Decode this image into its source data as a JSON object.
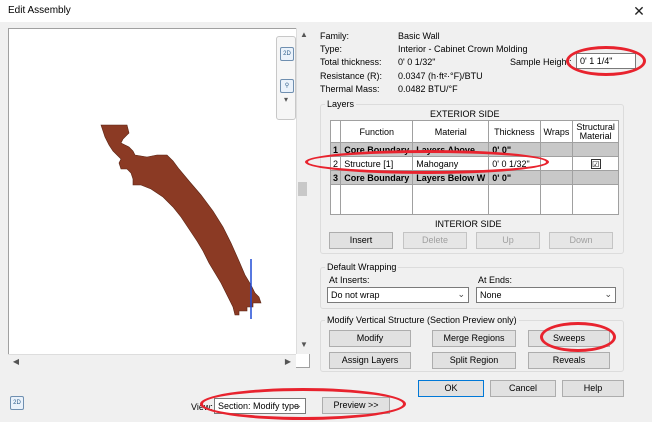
{
  "window": {
    "title": "Edit Assembly",
    "close_glyph": "✕"
  },
  "properties": {
    "family_label": "Family:",
    "family_value": "Basic Wall",
    "type_label": "Type:",
    "type_value": "Interior - Cabinet Crown Molding",
    "total_thickness_label": "Total thickness:",
    "total_thickness_value": "0'  0 1/32\"",
    "resistance_label": "Resistance (R):",
    "resistance_value": "0.0347 (h·ft²·°F)/BTU",
    "thermal_mass_label": "Thermal Mass:",
    "thermal_mass_value": "0.0482 BTU/°F",
    "sample_height_label": "Sample Height:",
    "sample_height_value": "0'  1 1/4\""
  },
  "layers": {
    "group_title": "Layers",
    "exterior_label": "EXTERIOR SIDE",
    "interior_label": "INTERIOR SIDE",
    "columns": [
      "Function",
      "Material",
      "Thickness",
      "Wraps",
      "Structural Material"
    ],
    "rows": [
      {
        "num": "1",
        "function": "Core Boundary",
        "material": "Layers Above",
        "thickness": "0'  0\"",
        "wraps": "",
        "structural": ""
      },
      {
        "num": "2",
        "function": "Structure [1]",
        "material": "Mahogany",
        "thickness": "0'  0 1/32\"",
        "wraps": "",
        "structural": "☑"
      },
      {
        "num": "3",
        "function": "Core Boundary",
        "material": "Layers Below W",
        "thickness": "0'  0\"",
        "wraps": "",
        "structural": ""
      }
    ],
    "buttons": {
      "insert": "Insert",
      "delete": "Delete",
      "up": "Up",
      "down": "Down"
    }
  },
  "default_wrapping": {
    "group_title": "Default Wrapping",
    "at_inserts_label": "At Inserts:",
    "at_inserts_value": "Do not wrap",
    "at_ends_label": "At Ends:",
    "at_ends_value": "None"
  },
  "modify_vertical": {
    "group_title": "Modify Vertical Structure (Section Preview only)",
    "modify": "Modify",
    "merge_regions": "Merge Regions",
    "sweeps": "Sweeps",
    "assign_layers": "Assign Layers",
    "split_region": "Split Region",
    "reveals": "Reveals"
  },
  "footer": {
    "ok": "OK",
    "cancel": "Cancel",
    "help": "Help",
    "view_label": "View:",
    "view_value": "Section: Modify type",
    "preview_button": "Preview >>"
  },
  "icons": {
    "nav_2d": "2D",
    "bottom_2d": "2D",
    "dropdown_arrow": "⌄"
  },
  "colors": {
    "molding": "#8b3a24",
    "highlight_oval": "#e8232e",
    "edge_line": "#1f4bd6"
  }
}
